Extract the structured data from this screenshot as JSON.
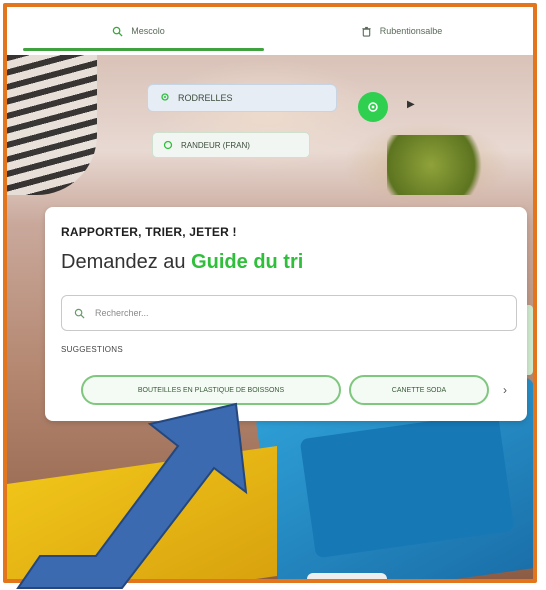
{
  "tabs": [
    {
      "label": "Mescolo"
    },
    {
      "label": "Rubentionsalbe"
    }
  ],
  "location": {
    "value": "RODRELLES",
    "suggestion": "RANDEUR (FRAN)"
  },
  "card": {
    "heading": "RAPPORTER, TRIER, JETER !",
    "subtitle_prefix": "Demandez au",
    "subtitle_highlight": "Guide du tri",
    "search_placeholder": "Rechercher...",
    "suggestions_label": "SUGGESTIONS",
    "chips": [
      {
        "label": "BOUTEILLES EN PLASTIQUE DE BOISSONS"
      },
      {
        "label": "CANETTE SODA"
      }
    ]
  },
  "colors": {
    "accent_green": "#2fbf3b",
    "frame_orange": "#e3761d",
    "arrow_blue": "#3b6ab0"
  },
  "icons": {
    "tab1": "search-icon",
    "tab2": "trash-icon",
    "location": "pin-icon",
    "go": "locate-icon",
    "more": "chevron-right-icon",
    "search": "search-icon"
  }
}
